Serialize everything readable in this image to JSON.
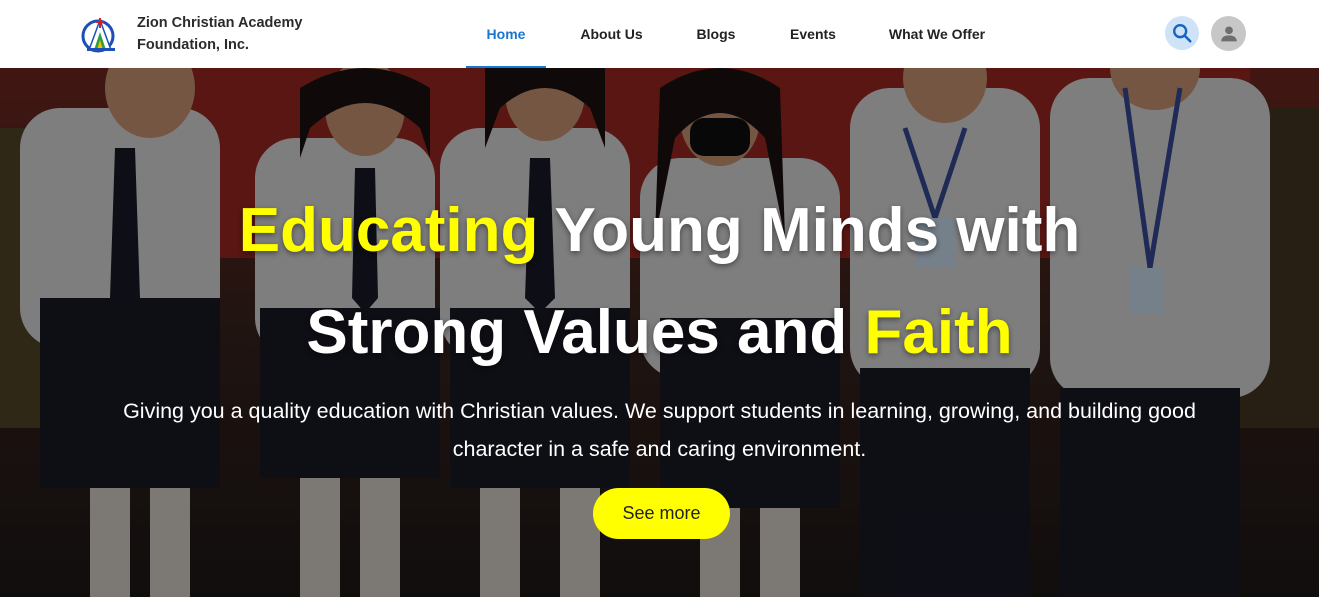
{
  "brand": {
    "name_line1": "Zion Christian Academy",
    "name_line2": "Foundation, Inc.",
    "logo_icon": "school-logo-icon"
  },
  "nav": {
    "items": [
      {
        "label": "Home",
        "active": true
      },
      {
        "label": "About Us",
        "active": false
      },
      {
        "label": "Blogs",
        "active": false
      },
      {
        "label": "Events",
        "active": false
      },
      {
        "label": "What We Offer",
        "active": false
      }
    ]
  },
  "header_actions": {
    "search_icon": "search-icon",
    "profile_icon": "user-avatar-icon"
  },
  "hero": {
    "headline_part1_highlight": "Educating",
    "headline_part1_rest": " Young Minds with",
    "headline_part2_rest": "Strong Values and ",
    "headline_part2_highlight": "Faith",
    "subtext": "Giving you a quality education with Christian values. We support students in learning, growing, and building good character in a safe and caring environment.",
    "cta_label": "See more",
    "background_image": "students in uniforms giving thumbs up"
  },
  "colors": {
    "accent_blue": "#1976d2",
    "highlight_yellow": "#ffff00",
    "header_bg": "#ffffff"
  }
}
